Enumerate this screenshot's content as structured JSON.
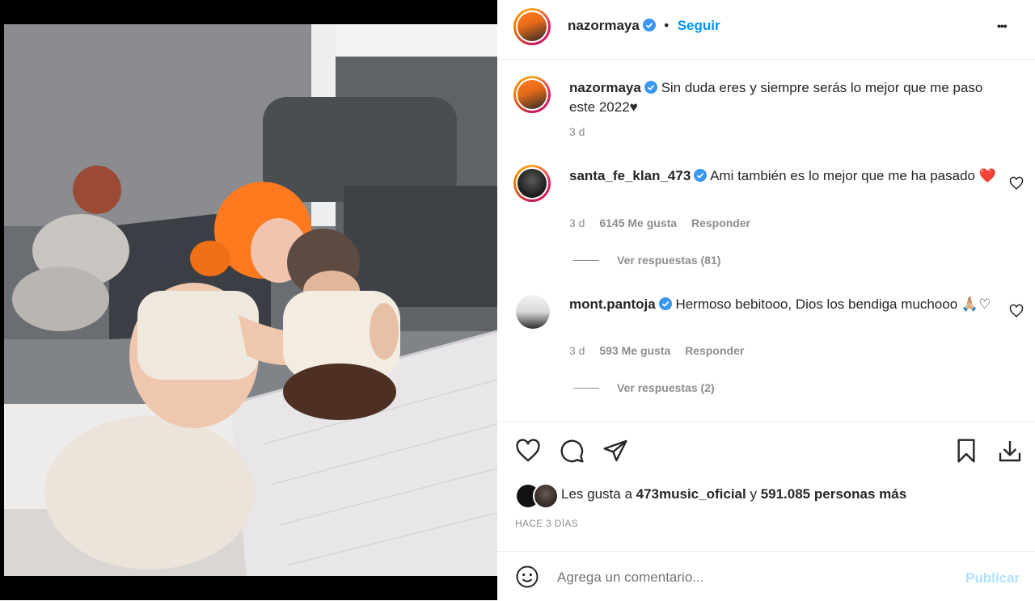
{
  "header": {
    "username": "nazormaya",
    "separator": "•",
    "follow_label": "Seguir",
    "more_label": "•••"
  },
  "caption": {
    "username": "nazormaya",
    "text": "Sin duda eres y siempre serás lo mejor que me paso este 2022♥",
    "time": "3 d"
  },
  "comments": [
    {
      "username": "santa_fe_klan_473",
      "text": "Ami también es lo mejor que me ha pasado",
      "emoji": "❤️",
      "time": "3 d",
      "likes": "6145 Me gusta",
      "reply_label": "Responder",
      "view_replies": "Ver respuestas (81)"
    },
    {
      "username": "mont.pantoja",
      "text": "Hermoso bebitooo, Dios los bendiga muchooo",
      "emoji": "🙏🏼♡",
      "time": "3 d",
      "likes": "593 Me gusta",
      "reply_label": "Responder",
      "view_replies": "Ver respuestas (2)"
    }
  ],
  "likes_summary": {
    "prefix": "Les gusta a",
    "account": "473music_oficial",
    "connector": "y",
    "others": "591.085 personas más"
  },
  "posted": "HACE 3 DÍAS",
  "comment_input": {
    "placeholder": "Agrega un comentario...",
    "publish_label": "Publicar"
  },
  "icons": {
    "like": "heart-icon",
    "comment": "comment-icon",
    "share": "share-icon",
    "save": "bookmark-icon",
    "download": "download-icon",
    "emoji": "emoji-icon",
    "verified": "verified-badge-icon"
  },
  "colors": {
    "accent_blue": "#0095f6",
    "verified_blue": "#3897f0",
    "muted": "#8e8e8e",
    "heart_red": "#e0245e"
  }
}
